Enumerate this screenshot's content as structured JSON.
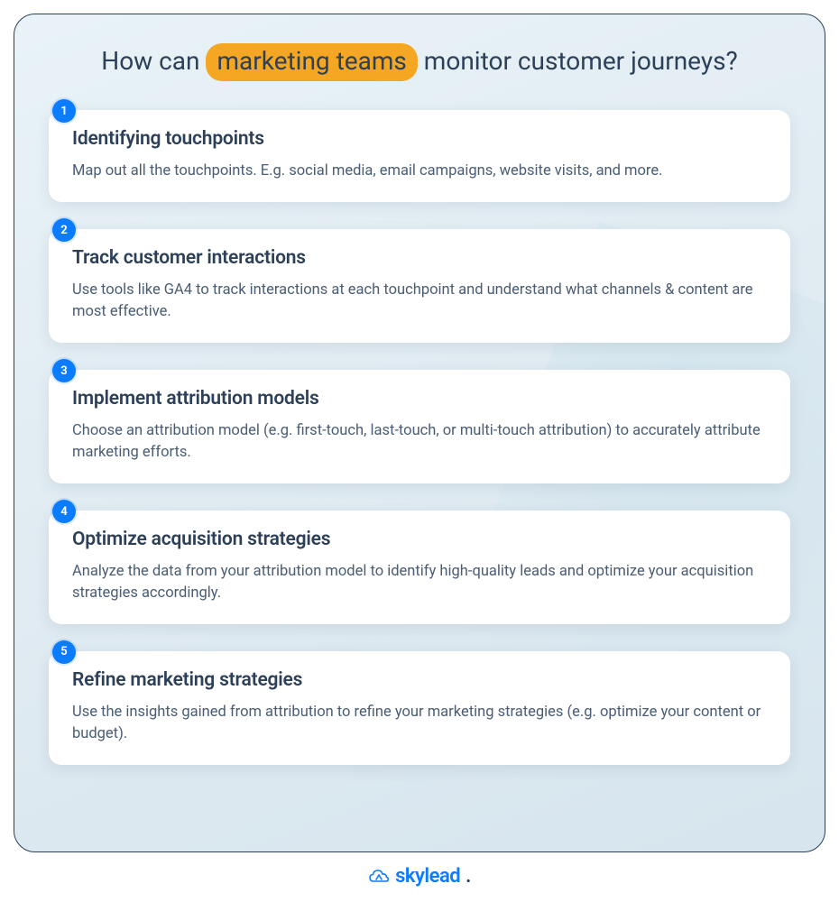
{
  "title": {
    "pre": "How can",
    "highlight": "marketing teams",
    "post": "monitor customer journeys?"
  },
  "steps": [
    {
      "num": "1",
      "heading": "Identifying  touchpoints",
      "body": "Map out all the touchpoints. E.g. social media, email campaigns, website visits, and more."
    },
    {
      "num": "2",
      "heading": "Track customer interactions",
      "body": "Use tools like GA4 to track interactions at each touchpoint and understand what channels & content are most effective."
    },
    {
      "num": "3",
      "heading": "Implement attribution models",
      "body": "Choose an attribution model (e.g. first-touch, last-touch, or multi-touch attribution) to accurately attribute marketing efforts."
    },
    {
      "num": "4",
      "heading": "Optimize acquisition strategies",
      "body": "Analyze the data from your attribution model to identify high-quality leads and optimize your acquisition strategies accordingly."
    },
    {
      "num": "5",
      "heading": "Refine marketing strategies",
      "body": "Use the insights gained from attribution to refine your marketing strategies (e.g. optimize your content or budget)."
    }
  ],
  "brand": {
    "name": "skylead",
    "dot": "."
  },
  "colors": {
    "accent": "#0b7bff",
    "highlight": "#f5a623",
    "text": "#2d4059",
    "subtext": "#4a5d74",
    "panel_bg": "#e8f2f7",
    "card_bg": "#ffffff"
  }
}
